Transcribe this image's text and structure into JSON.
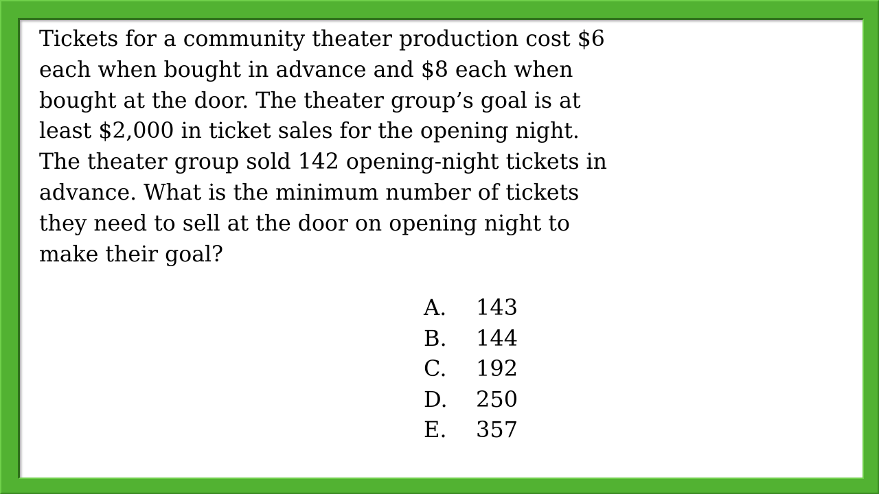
{
  "colors": {
    "frame_green": "#52b232",
    "frame_dark": "#2e6f1b",
    "background": "#ffffff",
    "text": "#000000"
  },
  "question": {
    "lines": [
      "Tickets for a community theater production cost $6",
      "each when bought in advance and $8 each when",
      "bought at the door.  The theater group’s goal is at",
      "least $2,000 in ticket sales for the opening night.",
      "The theater group sold 142 opening-night tickets in",
      "advance.  What is the minimum number of tickets",
      "they need to sell at the door on opening night to",
      "make their goal?"
    ]
  },
  "choices": [
    {
      "letter": "A.",
      "value": "143"
    },
    {
      "letter": "B.",
      "value": "144"
    },
    {
      "letter": "C.",
      "value": "192"
    },
    {
      "letter": "D.",
      "value": "250"
    },
    {
      "letter": "E.",
      "value": "357"
    }
  ]
}
